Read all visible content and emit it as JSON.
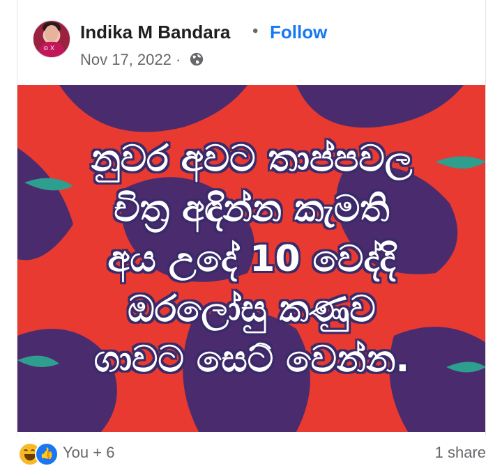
{
  "post": {
    "author": "Indika M Bandara",
    "separator": "•",
    "follow_label": "Follow",
    "date": "Nov 17, 2022 ·",
    "privacy_icon": "globe-icon",
    "text_lines": [
      "නුවර අවට තාප්පවල",
      "චිත්‍ර අඳින්න කැමති",
      "අය උදේ 10 වෙද්දි",
      "ඔරලෝසු කණුව",
      "ගාවට සෙට් වෙන්න."
    ],
    "image_colors": {
      "background": "#e83a30",
      "pattern": "#4a2c6e",
      "leaf": "#2e9e8f"
    }
  },
  "footer": {
    "reaction_icons": [
      "haha-icon",
      "like-icon"
    ],
    "reaction_count": "You + 6",
    "shares": "1 share"
  }
}
